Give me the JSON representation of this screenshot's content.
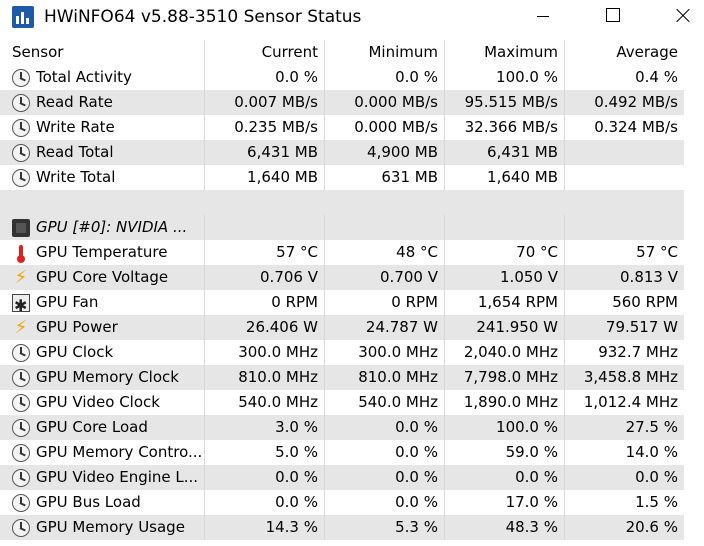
{
  "window": {
    "title": "HWiNFO64 v5.88-3510 Sensor Status",
    "app_icon": "hwinfo-icon"
  },
  "columns": {
    "sensor": "Sensor",
    "current": "Current",
    "minimum": "Minimum",
    "maximum": "Maximum",
    "average": "Average"
  },
  "rows": [
    {
      "icon": "clock-icon",
      "name": "Total Activity",
      "current": "0.0 %",
      "minimum": "0.0 %",
      "maximum": "100.0 %",
      "average": "0.4 %"
    },
    {
      "icon": "clock-icon",
      "name": "Read Rate",
      "current": "0.007 MB/s",
      "minimum": "0.000 MB/s",
      "maximum": "95.515 MB/s",
      "average": "0.492 MB/s"
    },
    {
      "icon": "clock-icon",
      "name": "Write Rate",
      "current": "0.235 MB/s",
      "minimum": "0.000 MB/s",
      "maximum": "32.366 MB/s",
      "average": "0.324 MB/s"
    },
    {
      "icon": "clock-icon",
      "name": "Read Total",
      "current": "6,431 MB",
      "minimum": "4,900 MB",
      "maximum": "6,431 MB",
      "average": ""
    },
    {
      "icon": "clock-icon",
      "name": "Write Total",
      "current": "1,640 MB",
      "minimum": "631 MB",
      "maximum": "1,640 MB",
      "average": ""
    }
  ],
  "group": {
    "icon": "chip-icon",
    "name": "GPU [#0]: NVIDIA ..."
  },
  "gpu_rows": [
    {
      "icon": "thermometer-icon",
      "name": "GPU Temperature",
      "current": "57 °C",
      "minimum": "48 °C",
      "maximum": "70 °C",
      "average": "57 °C"
    },
    {
      "icon": "lightning-icon",
      "name": "GPU Core Voltage",
      "current": "0.706 V",
      "minimum": "0.700 V",
      "maximum": "1.050 V",
      "average": "0.813 V"
    },
    {
      "icon": "fan-icon",
      "name": "GPU Fan",
      "current": "0 RPM",
      "minimum": "0 RPM",
      "maximum": "1,654 RPM",
      "average": "560 RPM"
    },
    {
      "icon": "lightning-icon",
      "name": "GPU Power",
      "current": "26.406 W",
      "minimum": "24.787 W",
      "maximum": "241.950 W",
      "average": "79.517 W"
    },
    {
      "icon": "clock-icon",
      "name": "GPU Clock",
      "current": "300.0 MHz",
      "minimum": "300.0 MHz",
      "maximum": "2,040.0 MHz",
      "average": "932.7 MHz"
    },
    {
      "icon": "clock-icon",
      "name": "GPU Memory Clock",
      "current": "810.0 MHz",
      "minimum": "810.0 MHz",
      "maximum": "7,798.0 MHz",
      "average": "3,458.8 MHz"
    },
    {
      "icon": "clock-icon",
      "name": "GPU Video Clock",
      "current": "540.0 MHz",
      "minimum": "540.0 MHz",
      "maximum": "1,890.0 MHz",
      "average": "1,012.4 MHz"
    },
    {
      "icon": "clock-icon",
      "name": "GPU Core Load",
      "current": "3.0 %",
      "minimum": "0.0 %",
      "maximum": "100.0 %",
      "average": "27.5 %"
    },
    {
      "icon": "clock-icon",
      "name": "GPU Memory Contro...",
      "current": "5.0 %",
      "minimum": "0.0 %",
      "maximum": "59.0 %",
      "average": "14.0 %"
    },
    {
      "icon": "clock-icon",
      "name": "GPU Video Engine L...",
      "current": "0.0 %",
      "minimum": "0.0 %",
      "maximum": "0.0 %",
      "average": "0.0 %"
    },
    {
      "icon": "clock-icon",
      "name": "GPU Bus Load",
      "current": "0.0 %",
      "minimum": "0.0 %",
      "maximum": "17.0 %",
      "average": "1.5 %"
    },
    {
      "icon": "clock-icon",
      "name": "GPU Memory Usage",
      "current": "14.3 %",
      "minimum": "5.3 %",
      "maximum": "48.3 %",
      "average": "20.6 %"
    }
  ]
}
